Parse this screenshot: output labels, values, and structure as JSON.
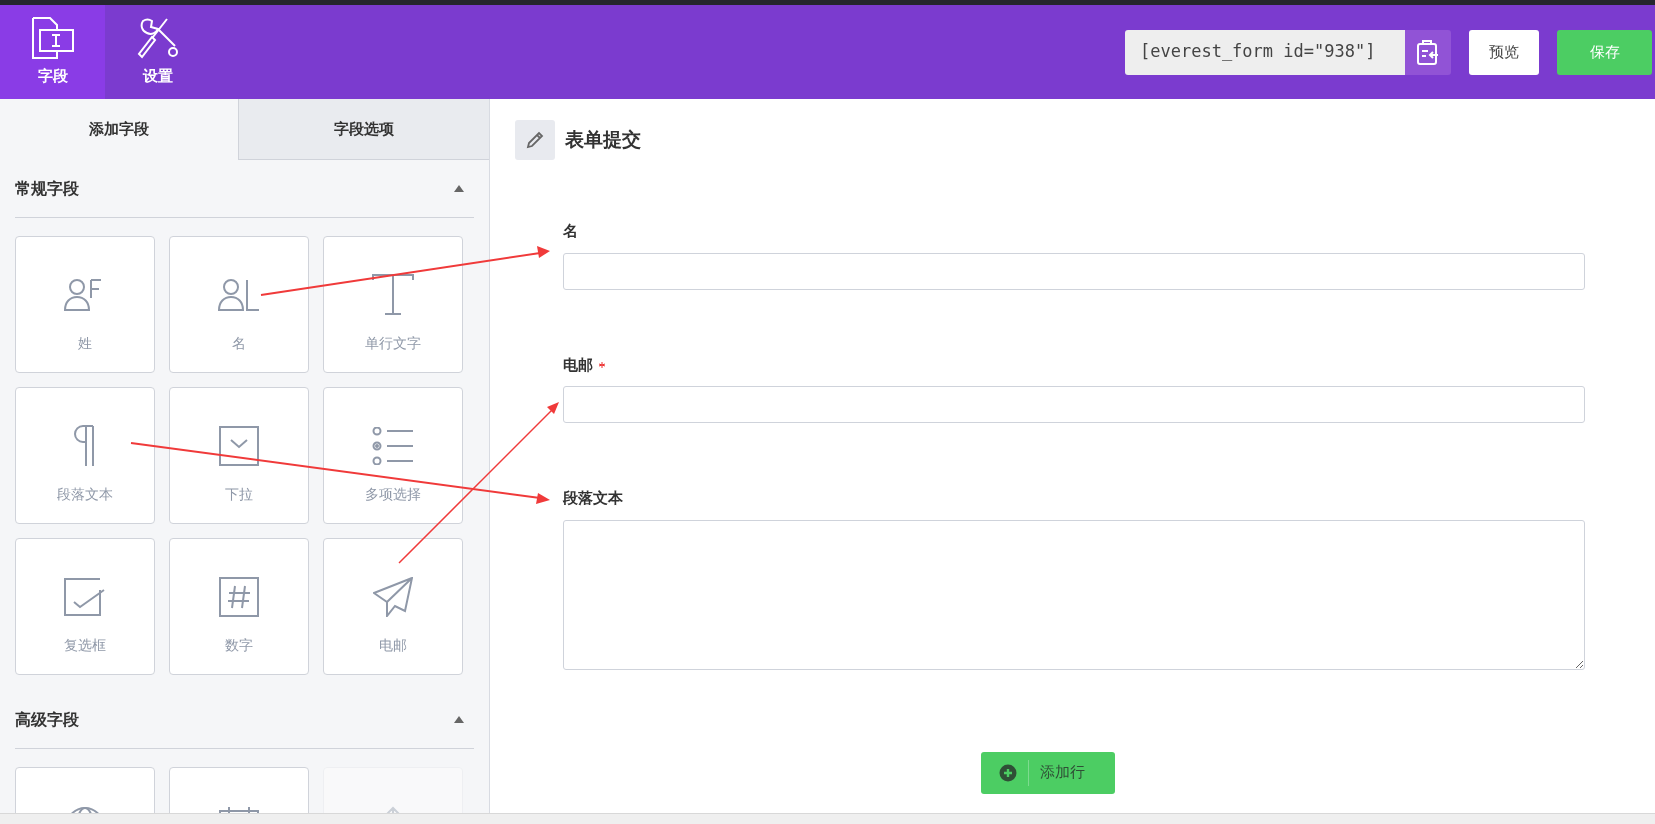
{
  "top_bar": {
    "nav_items": [
      {
        "label": "字段",
        "kind": "fields",
        "selected": true
      },
      {
        "label": "设置",
        "kind": "settings",
        "selected": false
      }
    ],
    "shortcode": "[everest_form id=\"938\"]",
    "preview_button": "预览",
    "save_button": "保存"
  },
  "left_panel": {
    "tabs": [
      {
        "label": "添加字段",
        "selected": true
      },
      {
        "label": "字段选项",
        "selected": false
      }
    ],
    "sections": [
      {
        "title": "常规字段",
        "expanded": true,
        "fields": [
          {
            "label": "姓",
            "kind": "lastname",
            "disabled": false
          },
          {
            "label": "名",
            "kind": "firstname",
            "disabled": false
          },
          {
            "label": "单行文字",
            "kind": "text",
            "disabled": false
          },
          {
            "label": "段落文本",
            "kind": "textarea",
            "disabled": false
          },
          {
            "label": "下拉",
            "kind": "select",
            "disabled": false
          },
          {
            "label": "多项选择",
            "kind": "radio",
            "disabled": false
          },
          {
            "label": "复选框",
            "kind": "checkbox",
            "disabled": false
          },
          {
            "label": "数字",
            "kind": "number",
            "disabled": false
          },
          {
            "label": "电邮",
            "kind": "email",
            "disabled": false
          }
        ]
      },
      {
        "title": "高级字段",
        "expanded": true,
        "fields": [
          {
            "kind": "url",
            "disabled": false
          },
          {
            "kind": "date",
            "disabled": false
          },
          {
            "kind": "upload",
            "disabled": true
          }
        ]
      }
    ]
  },
  "form": {
    "title": "表单提交",
    "fields": [
      {
        "label": "名",
        "kind": "input",
        "required": false
      },
      {
        "label": "电邮",
        "kind": "input",
        "required": true
      },
      {
        "label": "段落文本",
        "kind": "textarea",
        "required": false
      }
    ],
    "add_row_button": "添加行"
  }
}
